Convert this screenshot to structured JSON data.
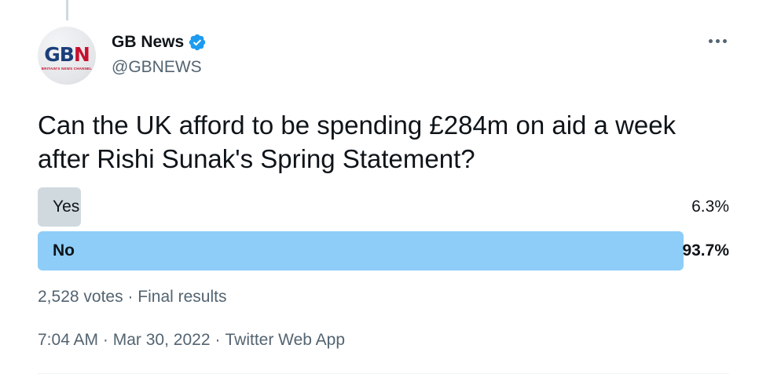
{
  "author": {
    "display_name": "GB News",
    "handle": "@GBNEWS",
    "verified": true,
    "avatar": {
      "logo_prefix": "GB",
      "logo_suffix": "N",
      "tagline": "BRITAIN'S NEWS CHANNEL"
    }
  },
  "tweet": {
    "text": "Can the UK afford to be spending £284m on aid a week after Rishi Sunak's Spring Statement?"
  },
  "poll": {
    "options": [
      {
        "label": "Yes",
        "percent_text": "6.3%",
        "percent": 6.3,
        "winner": false
      },
      {
        "label": "No",
        "percent_text": "93.7%",
        "percent": 93.7,
        "winner": true
      }
    ],
    "votes": "2,528 votes",
    "status": "Final results",
    "separator": "·"
  },
  "meta": {
    "time": "7:04 AM",
    "date": "Mar 30, 2022",
    "source": "Twitter Web App",
    "separator": "·"
  },
  "colors": {
    "winner_bar": "#8ecdf8",
    "loser_bar": "#cfd9de",
    "verified_badge": "#1d9bf0",
    "logo_blue": "#1c3f7a",
    "logo_red": "#c8102e"
  },
  "icons": {
    "verified": "verified-badge-icon",
    "more": "more-options-icon"
  }
}
